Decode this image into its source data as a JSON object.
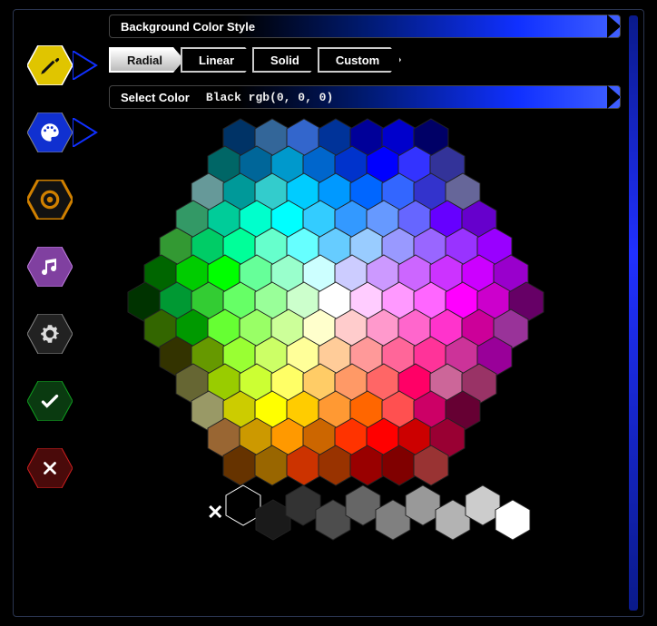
{
  "header": {
    "title": "Background Color Style"
  },
  "tabs": [
    {
      "label": "Radial",
      "active": true
    },
    {
      "label": "Linear",
      "active": false
    },
    {
      "label": "Solid",
      "active": false
    },
    {
      "label": "Custom",
      "active": false
    }
  ],
  "select": {
    "label": "Select Color",
    "value": "Black rgb(0, 0, 0)"
  },
  "sidebar": [
    {
      "name": "pencil-icon",
      "color": "#e0c500",
      "active": true
    },
    {
      "name": "palette-icon",
      "color": "#1030d0",
      "active": false
    },
    {
      "name": "eye-icon",
      "color": "#d08000",
      "active": false
    },
    {
      "name": "music-icon",
      "color": "#a050c0",
      "active": false
    },
    {
      "name": "gear-icon",
      "color": "#606060",
      "active": false
    },
    {
      "name": "check-icon",
      "color": "#108020",
      "active": false
    },
    {
      "name": "close-icon",
      "color": "#b01010",
      "active": false
    }
  ],
  "selected_color": "#000000",
  "honeycomb_rows": [
    [
      "#003366",
      "#336699",
      "#3366CC",
      "#003399",
      "#000099",
      "#0000CC",
      "#000066"
    ],
    [
      "#006666",
      "#006699",
      "#0099CC",
      "#0066CC",
      "#0033CC",
      "#0000FF",
      "#3333FF",
      "#333399"
    ],
    [
      "#669999",
      "#009999",
      "#33CCCC",
      "#00CCFF",
      "#0099FF",
      "#0066FF",
      "#3366FF",
      "#3333CC",
      "#666699"
    ],
    [
      "#339966",
      "#00CC99",
      "#00FFCC",
      "#00FFFF",
      "#33CCFF",
      "#3399FF",
      "#6699FF",
      "#6666FF",
      "#6600FF",
      "#6600CC"
    ],
    [
      "#339933",
      "#00CC66",
      "#00FF99",
      "#66FFCC",
      "#66FFFF",
      "#66CCFF",
      "#99CCFF",
      "#9999FF",
      "#9966FF",
      "#9933FF",
      "#9900FF"
    ],
    [
      "#006600",
      "#00CC00",
      "#00FF00",
      "#66FF99",
      "#99FFCC",
      "#CCFFFF",
      "#CCCCFF",
      "#CC99FF",
      "#CC66FF",
      "#CC33FF",
      "#CC00FF",
      "#9900CC"
    ],
    [
      "#003300",
      "#009933",
      "#33CC33",
      "#66FF66",
      "#99FF99",
      "#CCFFCC",
      "#FFFFFF",
      "#FFCCFF",
      "#FF99FF",
      "#FF66FF",
      "#FF00FF",
      "#CC00CC",
      "#660066"
    ],
    [
      "#336600",
      "#009900",
      "#66FF33",
      "#99FF66",
      "#CCFF99",
      "#FFFFCC",
      "#FFCCCC",
      "#FF99CC",
      "#FF66CC",
      "#FF33CC",
      "#CC0099",
      "#993399"
    ],
    [
      "#333300",
      "#669900",
      "#99FF33",
      "#CCFF66",
      "#FFFF99",
      "#FFCC99",
      "#FF9999",
      "#FF6699",
      "#FF3399",
      "#CC3399",
      "#990099"
    ],
    [
      "#666633",
      "#99CC00",
      "#CCFF33",
      "#FFFF66",
      "#FFCC66",
      "#FF9966",
      "#FF6666",
      "#FF0066",
      "#CC6699",
      "#993366"
    ],
    [
      "#999966",
      "#CCCC00",
      "#FFFF00",
      "#FFCC00",
      "#FF9933",
      "#FF6600",
      "#FF5050",
      "#CC0066",
      "#660033"
    ],
    [
      "#996633",
      "#CC9900",
      "#FF9900",
      "#CC6600",
      "#FF3300",
      "#FF0000",
      "#CC0000",
      "#990033"
    ],
    [
      "#663300",
      "#996600",
      "#CC3300",
      "#993300",
      "#990000",
      "#800000",
      "#993333"
    ]
  ],
  "greyscale": [
    "#000000",
    "#1a1a1a",
    "#333333",
    "#4d4d4d",
    "#666666",
    "#808080",
    "#999999",
    "#b3b3b3",
    "#cccccc",
    "#ffffff"
  ]
}
